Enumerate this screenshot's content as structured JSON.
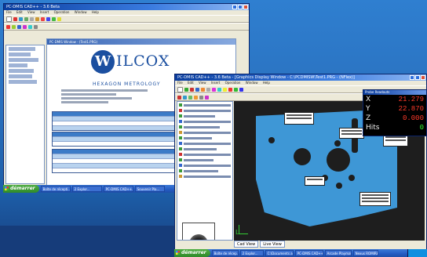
{
  "main_window": {
    "title": "PC-DMIS CAD++ - 3.6 Beta",
    "menu": [
      "File",
      "Edit",
      "View",
      "Insert",
      "Operation",
      "Window",
      "Help"
    ],
    "doc_title": "PC-DMIS Window - (Test1.PRG)",
    "logo_word": "ILCOX",
    "logo_initial": "W",
    "logo_subtitle": "HEXAGON METROLOGY"
  },
  "graphics_window": {
    "title": "PC-DMIS CAD++ - 3.6 Beta - [Graphics Display Window - C:\\PCDMISW\\Test1.PRG - (NFlex)]",
    "menu": [
      "File",
      "Edit",
      "View",
      "Insert",
      "Operation",
      "Window",
      "Help"
    ],
    "tabs": [
      "Cad View",
      "Live View"
    ],
    "axis_label": "L"
  },
  "probe_readouts": {
    "title": "Probe Readouts",
    "rows": [
      {
        "label": "X",
        "value": "21.279"
      },
      {
        "label": "Y",
        "value": "22.870"
      },
      {
        "label": "Z",
        "value": "0.000"
      },
      {
        "label": "Hits",
        "value": "0"
      }
    ]
  },
  "taskbar_back": {
    "start_label": "démarrer",
    "items": [
      "Boîte de récepti...",
      "2 Explor...",
      "PC-DMIS CAD++...",
      "Souvenir Pla..."
    ]
  },
  "taskbar_front": {
    "start_label": "démarrer",
    "items": [
      "Boîte de récep...",
      "2 Explor...",
      "C:\\Documents an...",
      "PC-DMIS CAD++...",
      "Arcade Playmate...",
      "Nexus ROMIRE..."
    ]
  },
  "colors": {
    "desktop": "#2a71bf",
    "part_fill": "#3e97d6",
    "readout_value": "#ff3a2a",
    "hits_value": "#30ff30",
    "canvas_bg": "#1e1e1e"
  }
}
